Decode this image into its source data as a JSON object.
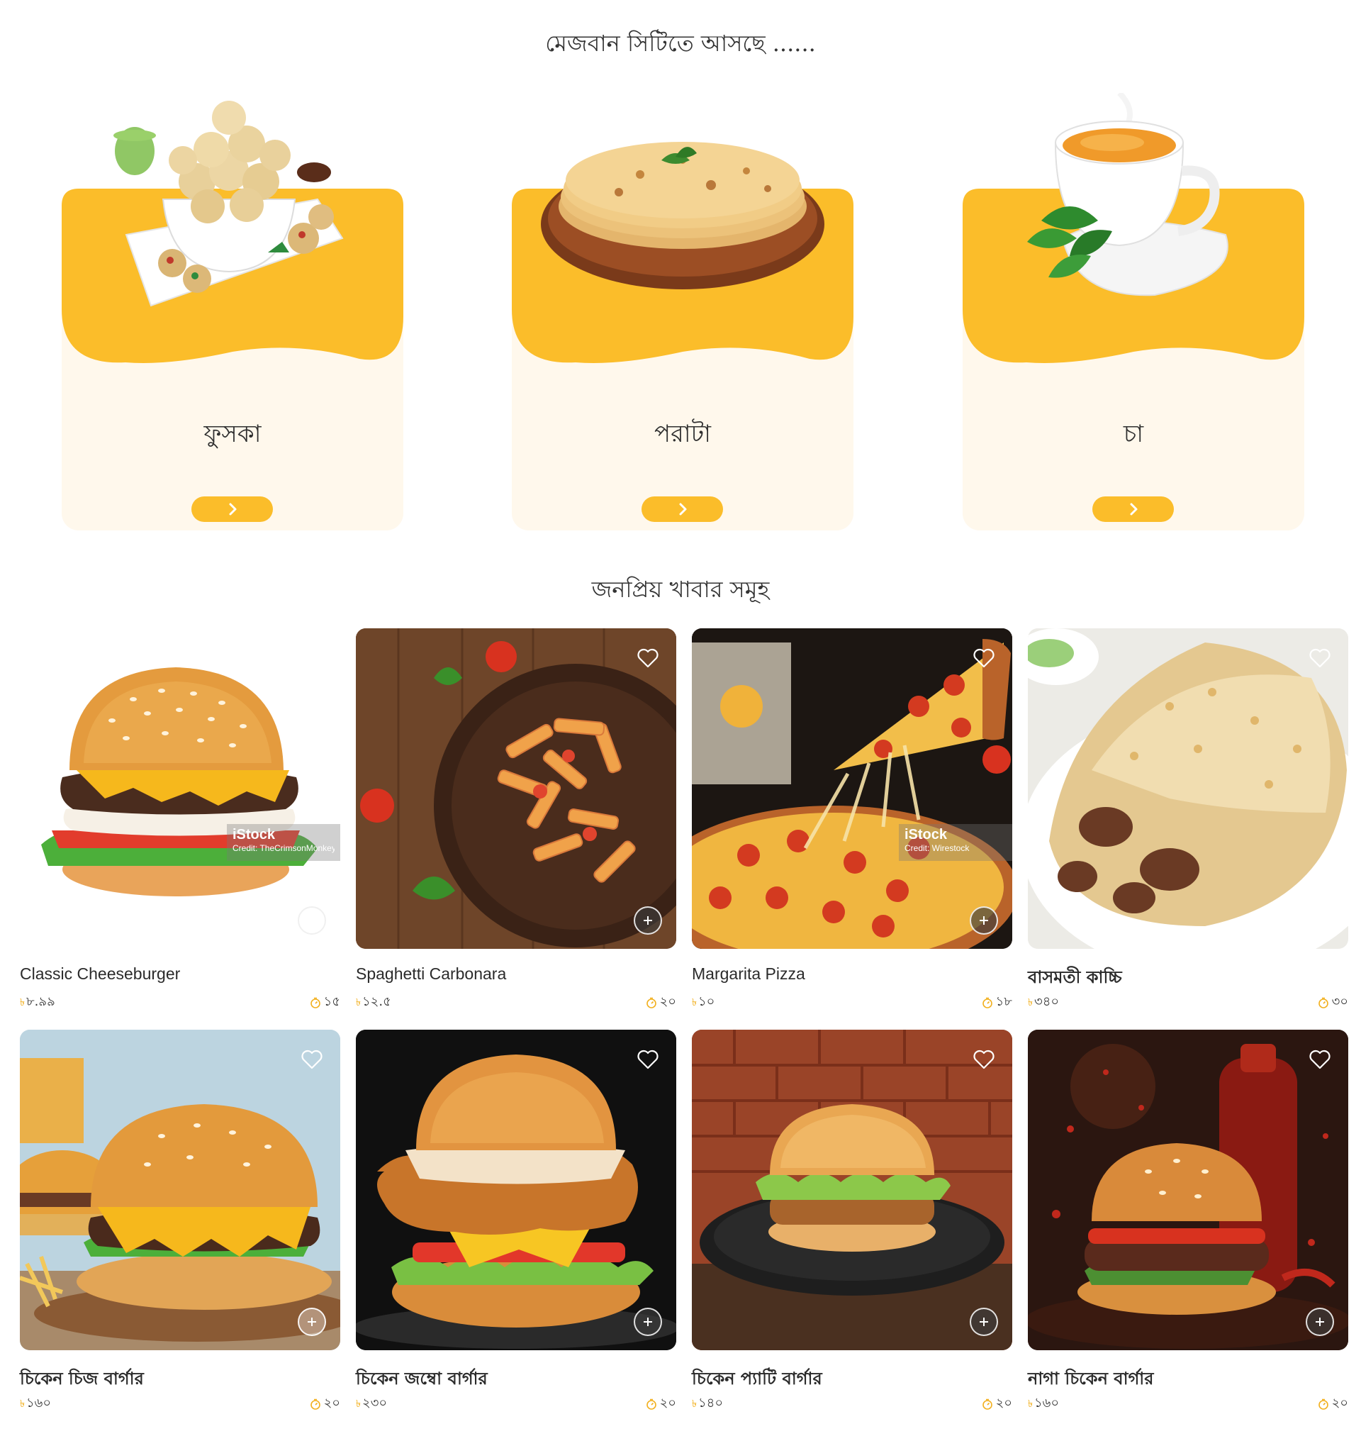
{
  "upcoming": {
    "title": "মেজবান সিটিতে আসছে ......",
    "items": [
      {
        "name": "ফুসকা",
        "icon": "fuchka-image"
      },
      {
        "name": "পরাটা",
        "icon": "paratha-image"
      },
      {
        "name": "চা",
        "icon": "tea-image"
      }
    ]
  },
  "popular": {
    "title": "জনপ্রিয় খাবার সমূহ",
    "items": [
      {
        "name": "Classic Cheeseburger",
        "currency": "৳",
        "price": "৮.৯৯",
        "time": "১৫",
        "watermark_brand": "iStock",
        "watermark_credit": "Credit: TheCrimsonMonkey"
      },
      {
        "name": "Spaghetti Carbonara",
        "currency": "৳",
        "price": "১২.৫",
        "time": "২০"
      },
      {
        "name": "Margarita Pizza",
        "currency": "৳",
        "price": "১০",
        "time": "১৮",
        "watermark_brand": "iStock",
        "watermark_credit": "Credit: Wirestock"
      },
      {
        "name": "বাসমতী কাচ্চি",
        "currency": "৳",
        "price": "৩৪০",
        "time": "৩০"
      },
      {
        "name": "চিকেন চিজ বার্গার",
        "currency": "৳",
        "price": "১৬০",
        "time": "২০"
      },
      {
        "name": "চিকেন জম্বো বার্গার",
        "currency": "৳",
        "price": "২৩০",
        "time": "২০"
      },
      {
        "name": "চিকেন প্যাটি বার্গার",
        "currency": "৳",
        "price": "১৪০",
        "time": "২০"
      },
      {
        "name": "নাগা চিকেন বার্গার",
        "currency": "৳",
        "price": "১৬০",
        "time": "২০"
      }
    ]
  },
  "colors": {
    "accent": "#fbbd2a",
    "card_bg": "#fff8ec",
    "text": "#2b2b2b"
  }
}
